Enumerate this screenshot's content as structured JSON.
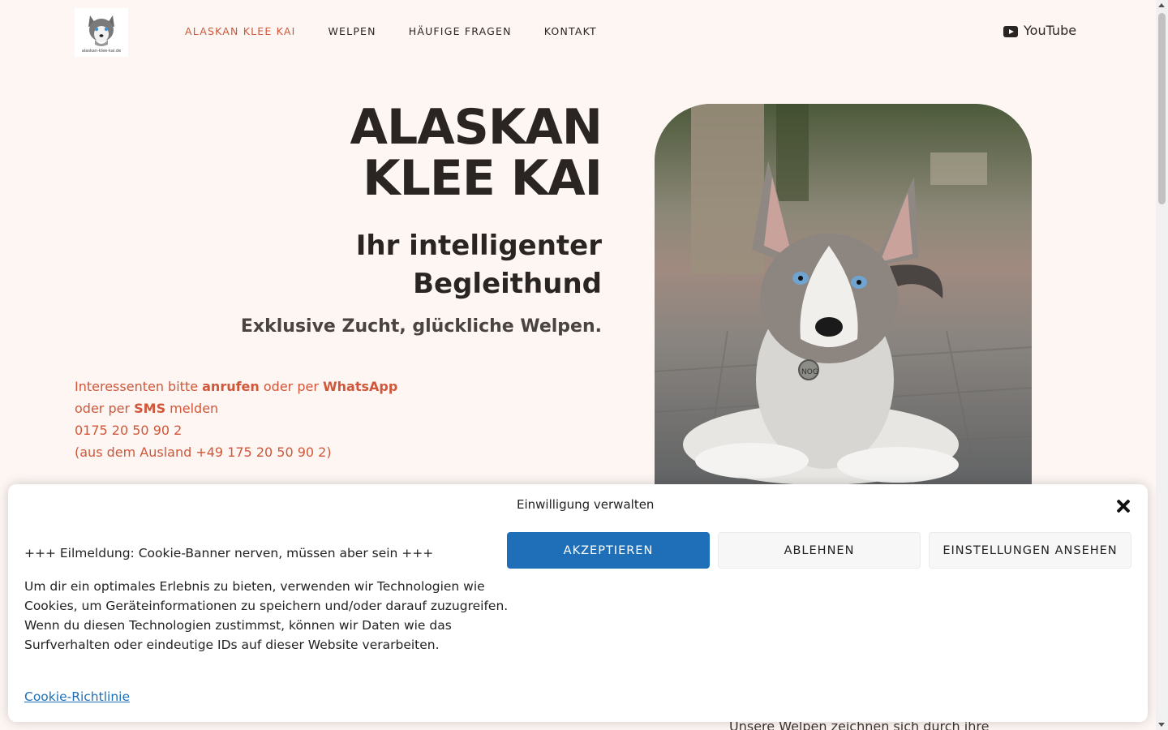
{
  "header": {
    "logo_text": "alaskan-klee-kai.de",
    "nav": [
      {
        "label": "ALASKAN KLEE KAI",
        "active": true
      },
      {
        "label": "WELPEN",
        "active": false
      },
      {
        "label": "HÄUFIGE FRAGEN",
        "active": false
      },
      {
        "label": "KONTAKT",
        "active": false
      }
    ],
    "youtube_label": "YouTube"
  },
  "hero": {
    "title_line1": "ALASKAN",
    "title_line2": "KLEE KAI",
    "subtitle_line1": "Ihr intelligenter",
    "subtitle_line2": "Begleithund",
    "tagline": "Exklusive Zucht, glückliche Welpen.",
    "contact": {
      "line1_pre": "Interessenten bitte ",
      "line1_b1": "anrufen",
      "line1_mid": " oder per ",
      "line1_b2": "WhatsApp",
      "line2_pre": "oder per ",
      "line2_b": "SMS",
      "line2_post": " melden",
      "phone": "0175 20 50 90 2",
      "abroad": "(aus dem Ausland +49 175 20 50 90 2)"
    },
    "photo_tag_text": "NOG"
  },
  "below_text": "Unsere Welpen zeichnen sich durch ihre",
  "cookie": {
    "title": "Einwilligung verwalten",
    "headline": "+++ Eilmeldung: Cookie-Banner nerven, müssen aber sein +++",
    "body": "Um dir ein optimales Erlebnis zu bieten, verwenden wir Technologien wie Cookies, um Geräteinformationen zu speichern und/oder darauf zuzugreifen. Wenn du diesen Technologien zustimmst, können wir Daten wie das Surfverhalten oder eindeutige IDs auf dieser Website verarbeiten.",
    "accept": "AKZEPTIEREN",
    "deny": "ABLEHNEN",
    "settings": "EINSTELLUNGEN ANSEHEN",
    "policy_link": "Cookie-Richtlinie"
  },
  "colors": {
    "background": "#fdf6f3",
    "accent": "#d0573a",
    "button_blue": "#1e6fb8",
    "text_dark": "#2a2522"
  },
  "icons": {
    "youtube": "youtube-icon",
    "close": "close-icon",
    "logo": "husky-logo-icon"
  }
}
